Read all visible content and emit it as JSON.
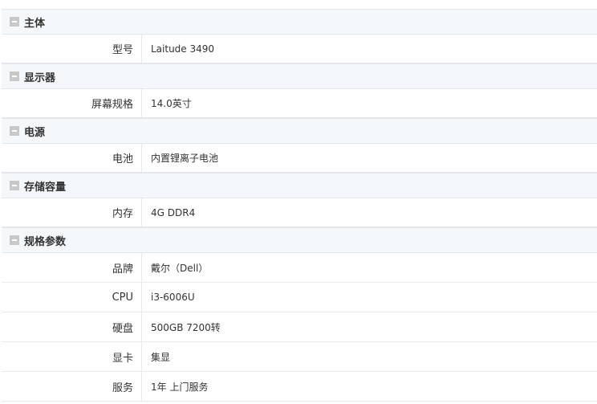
{
  "sections": [
    {
      "title": "主体",
      "rows": [
        {
          "key": "型号",
          "value": "Laitude 3490"
        }
      ]
    },
    {
      "title": "显示器",
      "rows": [
        {
          "key": "屏幕规格",
          "value": "14.0英寸"
        }
      ]
    },
    {
      "title": "电源",
      "rows": [
        {
          "key": "电池",
          "value": "内置锂离子电池"
        }
      ]
    },
    {
      "title": "存储容量",
      "rows": [
        {
          "key": "内存",
          "value": "4G DDR4"
        }
      ]
    },
    {
      "title": "规格参数",
      "rows": [
        {
          "key": "品牌",
          "value": "戴尔（Dell）"
        },
        {
          "key": "CPU",
          "value": "i3-6006U"
        },
        {
          "key": "硬盘",
          "value": "500GB 7200转"
        },
        {
          "key": "显卡",
          "value": "集显"
        },
        {
          "key": "服务",
          "value": "1年 上门服务"
        }
      ]
    }
  ]
}
